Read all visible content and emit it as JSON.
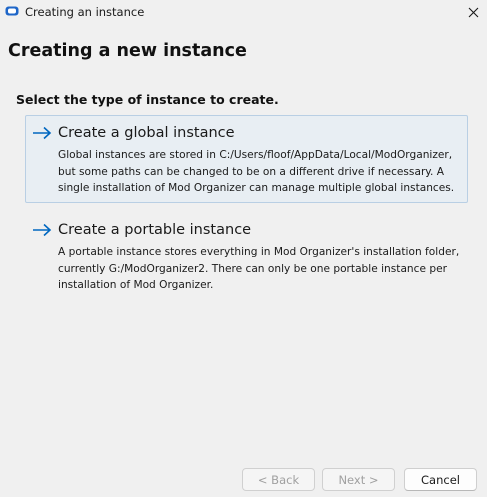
{
  "window": {
    "title": "Creating an instance",
    "app_icon": "mod-organizer-icon",
    "close_icon": "close-icon"
  },
  "page": {
    "title": "Creating a new instance",
    "prompt": "Select the type of instance to create."
  },
  "options": [
    {
      "title": "Create a global instance",
      "description": "Global instances are stored in C:/Users/floof/AppData/Local/ModOrganizer, but some paths can be changed to be on a different drive if necessary. A single installation of Mod Organizer can manage multiple global instances.",
      "icon": "arrow-right-icon",
      "selected": true
    },
    {
      "title": "Create a portable instance",
      "description": "A portable instance stores everything in Mod Organizer's installation folder, currently G:/ModOrganizer2. There can only be one portable instance per installation of Mod Organizer.",
      "icon": "arrow-right-icon",
      "selected": false
    }
  ],
  "buttons": {
    "back": "< Back",
    "next": "Next >",
    "cancel": "Cancel"
  },
  "colors": {
    "accent": "#0067c0",
    "selection_bg": "#e8eef3",
    "selection_border": "#b9cfe4",
    "window_bg": "#f0f0f0"
  }
}
